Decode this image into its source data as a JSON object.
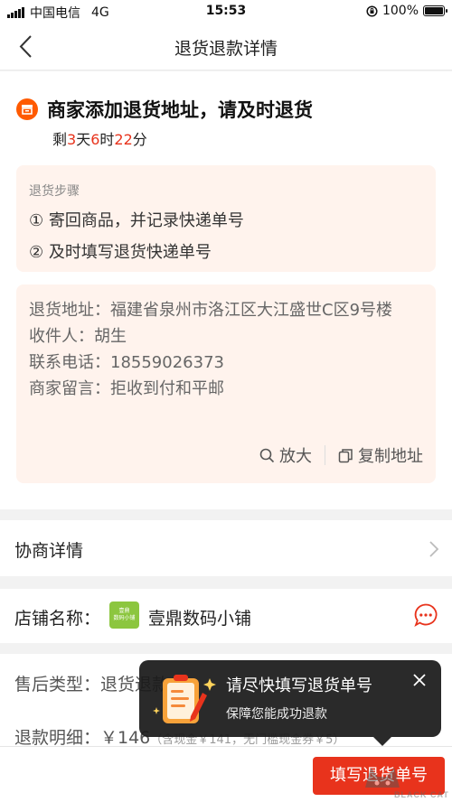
{
  "status_bar": {
    "carrier": "中国电信",
    "network": "4G",
    "time": "15:53",
    "battery_text": "100%",
    "battery_level": 1.0
  },
  "nav": {
    "title": "退货退款详情"
  },
  "header": {
    "title": "商家添加退货地址，请及时退货",
    "countdown": {
      "prefix": "剩",
      "days": "3",
      "days_unit": "天",
      "hours": "6",
      "hours_unit": "时",
      "minutes": "22",
      "minutes_unit": "分"
    }
  },
  "steps": {
    "title": "退货步骤",
    "items": [
      "① 寄回商品，并记录快递单号",
      "② 及时填写退货快递单号"
    ]
  },
  "address": {
    "line1": "退货地址：福建省泉州市洛江区大江盛世C区9号楼",
    "line2": "收件人：胡生",
    "line3": "联系电话：18559026373",
    "line4": "商家留言：拒收到付和平邮",
    "zoom_label": "放大",
    "copy_label": "复制地址"
  },
  "negotiate": {
    "label": "协商详情"
  },
  "store": {
    "label": "店铺名称：",
    "logo_text_1": "壹鼎",
    "logo_text_2": "数码小铺",
    "name": "壹鼎数码小铺"
  },
  "detail": {
    "type_text": "售后类型：退货退款",
    "refund_label": "退款明细：￥146",
    "refund_note": "（含现金￥141，无门槛现金券￥5）"
  },
  "tooltip": {
    "title": "请尽快填写退货单号",
    "subtitle": "保障您能成功退款"
  },
  "bottom": {
    "fill_button": "填写退货单号"
  },
  "watermark": {
    "text": "BLACK CAT"
  },
  "colors": {
    "accent": "#e8331c",
    "orange": "#ff5a00",
    "panel_bg": "#fff3ed"
  }
}
